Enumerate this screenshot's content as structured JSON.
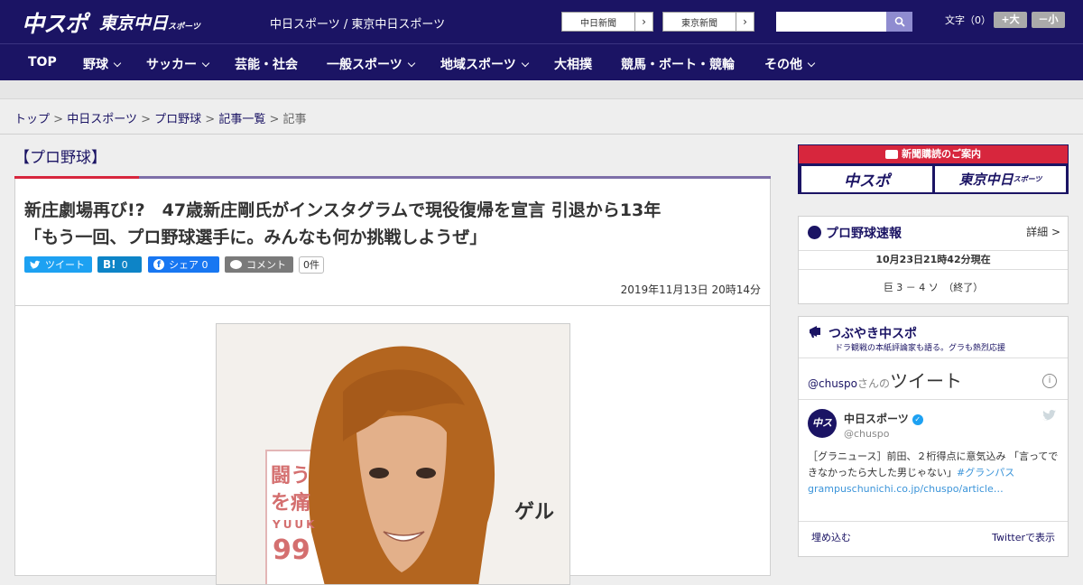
{
  "header": {
    "logo_chuspo": "中スポ",
    "logo_tokyo": "東京中日",
    "logo_tokyo_sub": "スポーツ",
    "site_title": "中日スポーツ / 東京中日スポーツ",
    "newspaper_link_1": "中日新聞",
    "newspaper_link_2": "東京新聞",
    "search_placeholder": "",
    "font_size_label": "文字（0）",
    "font_up": "+大",
    "font_down": "－小"
  },
  "nav": {
    "items": [
      "TOP",
      "野球",
      "サッカー",
      "芸能・社会",
      "一般スポーツ",
      "地域スポーツ",
      "大相撲",
      "競馬・ボート・競輪",
      "その他"
    ]
  },
  "breadcrumb": {
    "items": [
      "トップ",
      "中日スポーツ",
      "プロ野球",
      "記事一覧"
    ],
    "current": "記事",
    "sep": ">"
  },
  "category": "【プロ野球】",
  "article": {
    "headline_1": "新庄劇場再び!?　47歳新庄剛氏がインスタグラムで現役復帰を宣言 引退から13年",
    "headline_2": "「もう一回、プロ野球選手に。みんなも何か挑戦しようぜ」",
    "share_tweet": "ツイート",
    "share_hatena_count": "0",
    "share_facebook": "シェア 0",
    "share_comment": "コメント",
    "comment_count": "0件",
    "date": "2019年11月13日 20時14分",
    "photo_text_1": "闘う",
    "photo_text_2": "を痛",
    "photo_text_3": "YUUK",
    "photo_text_4": "99",
    "photo_text_5": "ゲル"
  },
  "sidebar": {
    "ad_title": "新聞購読のご案内",
    "ad_logo_1": "中スポ",
    "ad_logo_2": "東京中日",
    "ad_logo_2_sub": "スポーツ",
    "score_title": "プロ野球速報",
    "score_detail": "詳細 >",
    "score_time": "10月23日21時42分現在",
    "score_line": "巨 3 － 4 ソ　（終了）",
    "tweet_title": "つぶやき中スポ",
    "tweet_subtitle": "ドラ観戦の本紙評論家も語る。グラも熱烈応援",
    "tweet_header_user": "@chuspo",
    "tweet_header_suffix": "さんの",
    "tweet_header_big": "ツイート",
    "tweet_name": "中日スポーツ",
    "tweet_handle": "@chuspo",
    "tweet_avatar_text": "中スポ",
    "tweet_text": "［グラニュース］前田、２桁得点に意気込み 「言ってできなかったら大した男じゃない」",
    "tweet_tag": "#グランパス",
    "tweet_link": "grampuschunichi.co.jp/chuspo/article…",
    "embed": "埋め込む",
    "view_on_twitter": "Twitterで表示"
  },
  "colors": {
    "brand_navy": "#1b1464",
    "accent_red": "#d7263d",
    "twitter_blue": "#1da1f2"
  }
}
